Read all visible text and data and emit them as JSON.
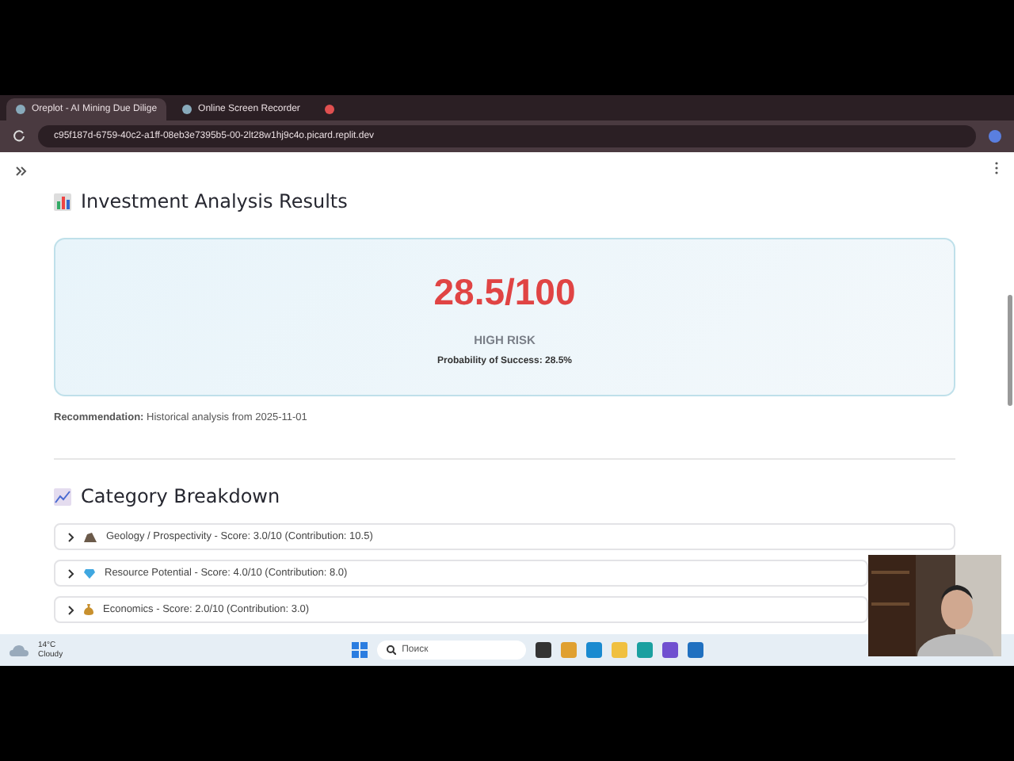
{
  "tabs": [
    {
      "label": "Oreplot - AI Mining Due Dilige",
      "selected": true
    },
    {
      "label": "Online Screen Recorder",
      "selected": false
    },
    {
      "selected": false
    }
  ],
  "address": "c95f187d-6759-40c2-a1ff-08eb3e7395b5-00-2lt28w1hj9c4o.picard.replit.dev",
  "results": {
    "title": "Investment Analysis Results",
    "score": "28.5/100",
    "risk": "HIGH RISK",
    "probability": "Probability of Success: 28.5%",
    "recommendation_label": "Recommendation:",
    "recommendation": "Historical analysis from 2025-11-01"
  },
  "breakdown": {
    "title": "Category Breakdown",
    "items": [
      {
        "kind": "rock",
        "label": "Geology / Prospectivity - Score: 3.0/10 (Contribution: 10.5)",
        "expanded": false
      },
      {
        "kind": "gem",
        "label": "Resource Potential - Score: 4.0/10 (Contribution: 8.0)",
        "expanded": false
      },
      {
        "kind": "money",
        "label": "Economics - Score: 2.0/10 (Contribution: 3.0)",
        "expanded": false
      }
    ]
  },
  "taskbar": {
    "temperature": "14°C",
    "weather": "Cloudy",
    "search_placeholder": "Поиск"
  }
}
